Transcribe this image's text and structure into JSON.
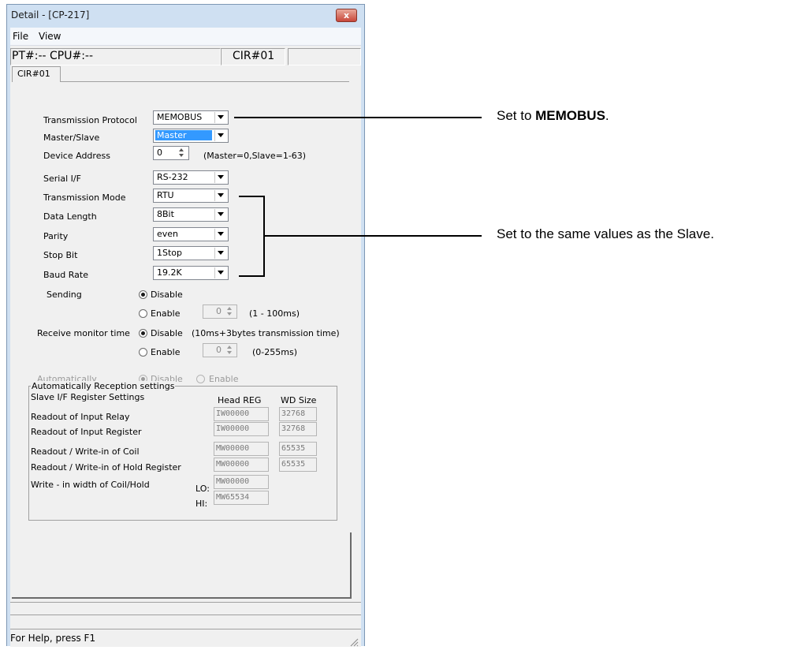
{
  "window": {
    "title": "Detail - [CP-217]",
    "close_glyph": "x"
  },
  "menu": {
    "file": "File",
    "view": "View"
  },
  "info": {
    "pt_cpu": "PT#:-- CPU#:--",
    "cir": "CIR#01"
  },
  "tab": {
    "label": "CIR#01"
  },
  "form": {
    "transmission_protocol": {
      "label": "Transmission Protocol",
      "value": "MEMOBUS"
    },
    "master_slave": {
      "label": "Master/Slave",
      "value": "Master"
    },
    "device_address": {
      "label": "Device Address",
      "value": "0",
      "hint": "(Master=0,Slave=1-63)"
    },
    "serial_if": {
      "label": "Serial I/F",
      "value": "RS-232"
    },
    "transmission_mode": {
      "label": "Transmission Mode",
      "value": "RTU"
    },
    "data_length": {
      "label": "Data Length",
      "value": "8Bit"
    },
    "parity": {
      "label": "Parity",
      "value": "even"
    },
    "stop_bit": {
      "label": "Stop Bit",
      "value": "1Stop"
    },
    "baud_rate": {
      "label": "Baud Rate",
      "value": "19.2K"
    },
    "sending": {
      "label": "Sending",
      "disable": "Disable",
      "enable": "Enable",
      "value": "0",
      "range": "(1 - 100ms)"
    },
    "receive_monitor": {
      "label": "Receive monitor time",
      "disable": "Disable",
      "disable_note": "(10ms+3bytes transmission time)",
      "enable": "Enable",
      "value": "0",
      "range": "(0-255ms)"
    },
    "automatically": {
      "label": "Automatically",
      "disable": "Disable",
      "enable": "Enable"
    }
  },
  "reception": {
    "group_title": "Automatically Reception settings",
    "header_label": "Slave I/F Register Settings",
    "head_reg": "Head REG",
    "wd_size": "WD Size",
    "rows": [
      {
        "label": "Readout of Input Relay",
        "reg": "IW00000",
        "size": "32768"
      },
      {
        "label": "Readout of Input Register",
        "reg": "IW00000",
        "size": "32768"
      },
      {
        "label": "Readout / Write-in of Coil",
        "reg": "MW00000",
        "size": "65535"
      },
      {
        "label": "Readout / Write-in of Hold Register",
        "reg": "MW00000",
        "size": "65535"
      }
    ],
    "write_width": {
      "label": "Write - in width of Coil/Hold",
      "lo_label": "LO:",
      "lo": "MW00000",
      "hi_label": "HI:",
      "hi": "MW65534"
    }
  },
  "status": {
    "help": "For Help, press F1"
  },
  "annotations": {
    "protocol_note_prefix": "Set to ",
    "protocol_note_bold": "MEMOBUS",
    "protocol_note_suffix": ".",
    "slave_note": "Set to the same values as the Slave."
  }
}
